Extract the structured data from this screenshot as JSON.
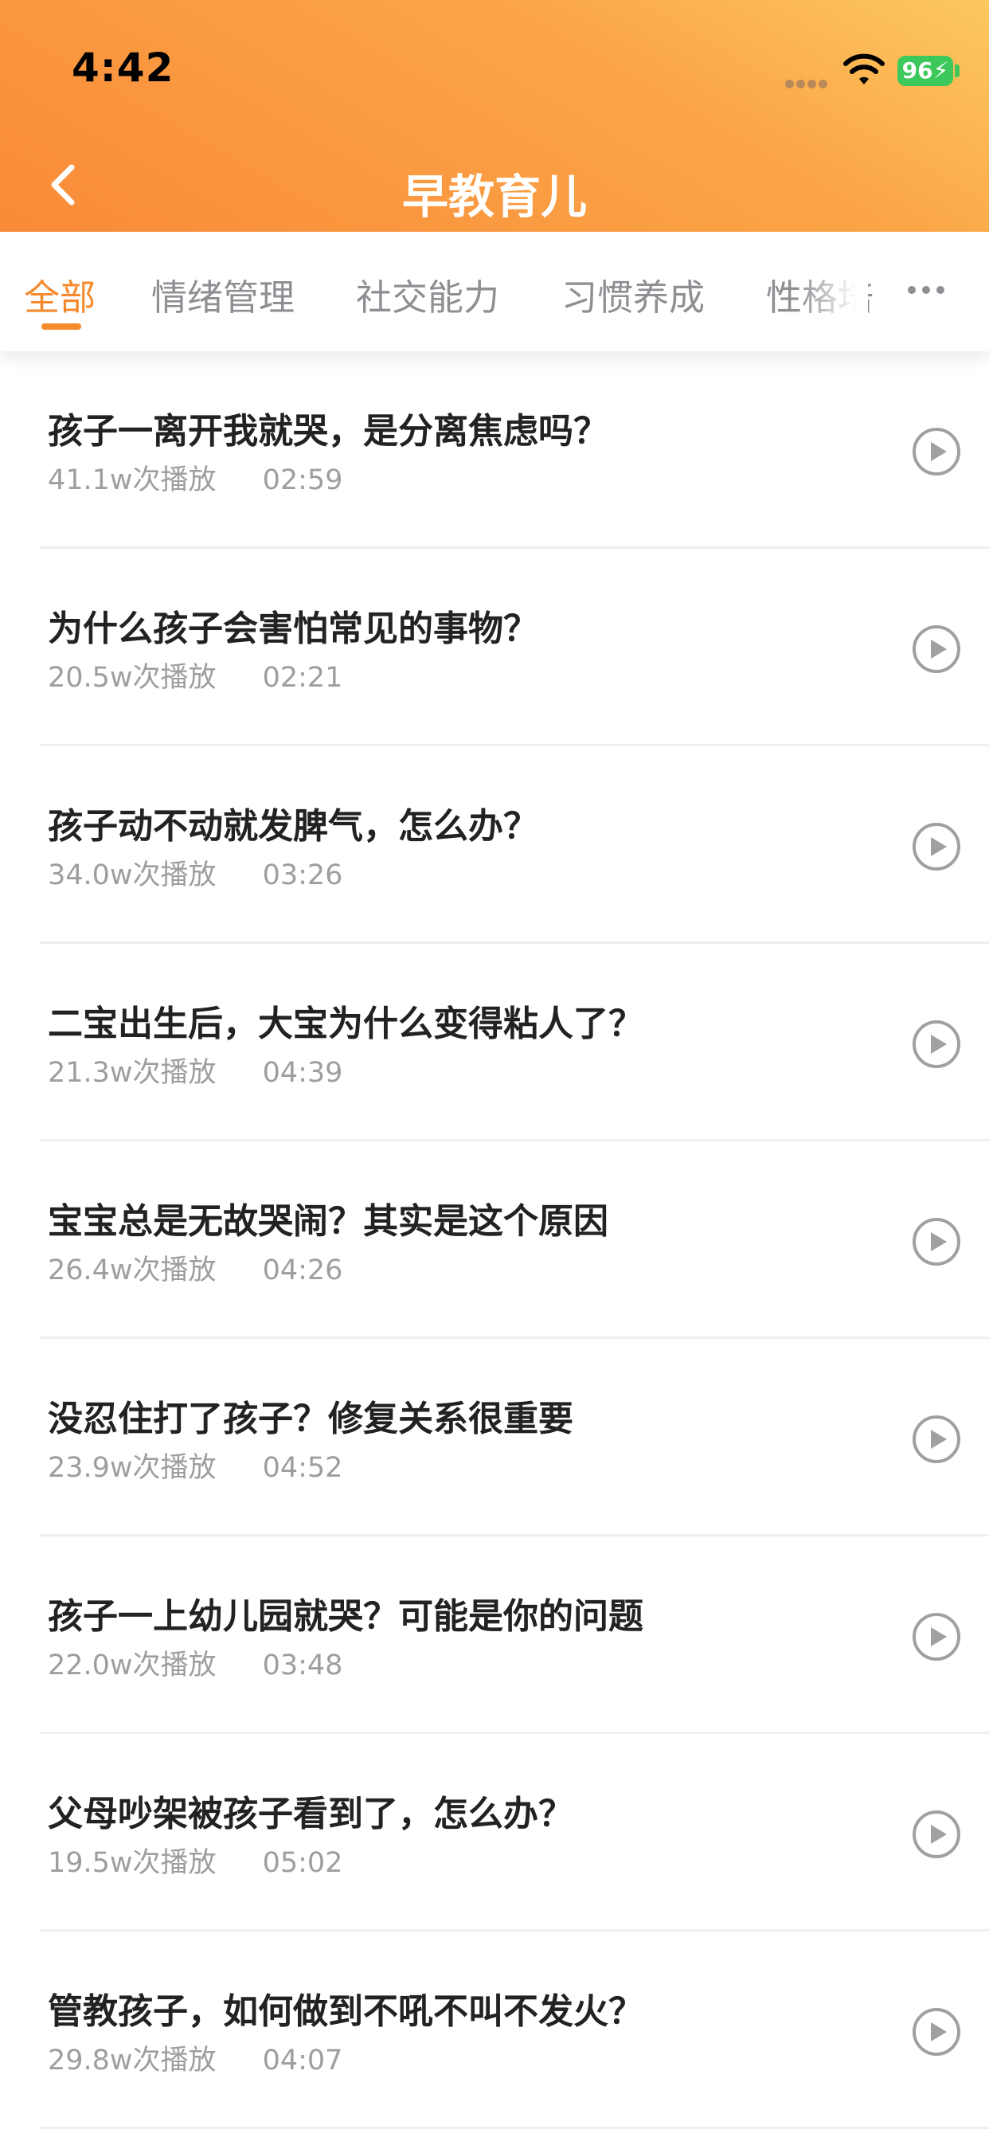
{
  "status": {
    "time": "4:42",
    "battery": "96"
  },
  "nav": {
    "title": "早教育儿"
  },
  "tabs": [
    {
      "label": "全部",
      "active": true
    },
    {
      "label": "情绪管理"
    },
    {
      "label": "社交能力"
    },
    {
      "label": "习惯养成"
    },
    {
      "label": "性格培"
    }
  ],
  "colors": {
    "accent": "#F68A2C",
    "header_start": "#F98B38",
    "header_end": "#FDC860"
  },
  "items": [
    {
      "title": "孩子一离开我就哭，是分离焦虑吗？",
      "plays": "41.1w次播放",
      "duration": "02:59"
    },
    {
      "title": "为什么孩子会害怕常见的事物？",
      "plays": "20.5w次播放",
      "duration": "02:21"
    },
    {
      "title": "孩子动不动就发脾气，怎么办？",
      "plays": "34.0w次播放",
      "duration": "03:26"
    },
    {
      "title": "二宝出生后，大宝为什么变得粘人了？",
      "plays": "21.3w次播放",
      "duration": "04:39"
    },
    {
      "title": "宝宝总是无故哭闹？其实是这个原因",
      "plays": "26.4w次播放",
      "duration": "04:26"
    },
    {
      "title": "没忍住打了孩子？修复关系很重要",
      "plays": "23.9w次播放",
      "duration": "04:52"
    },
    {
      "title": "孩子一上幼儿园就哭？可能是你的问题",
      "plays": "22.0w次播放",
      "duration": "03:48"
    },
    {
      "title": "父母吵架被孩子看到了，怎么办？",
      "plays": "19.5w次播放",
      "duration": "05:02"
    },
    {
      "title": "管教孩子，如何做到不吼不叫不发火？",
      "plays": "29.8w次播放",
      "duration": "04:07"
    }
  ]
}
